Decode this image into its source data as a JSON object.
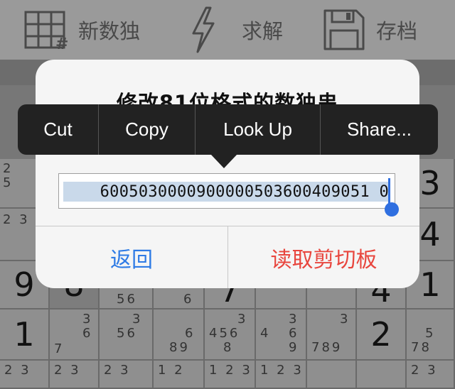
{
  "toolbar": {
    "new_label": "新数独",
    "solve_label": "求解",
    "save_label": "存档"
  },
  "dialog": {
    "title": "修改81位格式的数独串",
    "input_value": "6005030000900000503600409051 0",
    "back_label": "返回",
    "read_clipboard_label": "读取剪切板"
  },
  "edit_menu": {
    "cut": "Cut",
    "copy": "Copy",
    "look_up": "Look Up",
    "share": "Share..."
  },
  "grid": {
    "right_col_digits": [
      "3",
      "4",
      "1",
      "2"
    ],
    "row7_left": "9",
    "row7_second": "8",
    "row7_col7": "4",
    "row8_col1": "1",
    "row8_col7": "2",
    "row7_cands": [
      "56",
      "6",
      "7"
    ],
    "row8_cands": [
      {
        "lines": [
          "3",
          "6",
          "7"
        ]
      },
      {
        "lines": [
          "3",
          "56"
        ]
      },
      {
        "lines": [
          "6",
          "89"
        ]
      },
      {
        "lines": [
          "3",
          "456",
          "8"
        ]
      },
      {
        "lines": [
          "3",
          "4",
          "6",
          "9"
        ]
      },
      {
        "lines": [
          "3",
          "789"
        ]
      },
      {
        "lines": [
          "5",
          "78"
        ]
      }
    ],
    "left_col_cands": [
      [
        "2",
        "5"
      ],
      [
        "2 3"
      ]
    ],
    "bottom_cands": [
      "2 3",
      "2 3",
      "2 3",
      "1 2",
      "1 2 3",
      "1 2 3",
      "2 3"
    ]
  },
  "colors": {
    "dialog_bg": "#f5f5f5",
    "menu_bg": "#222222",
    "accent_blue": "#2f7be5",
    "destructive_red": "#e8463e",
    "selection": "#c9d9ea"
  }
}
